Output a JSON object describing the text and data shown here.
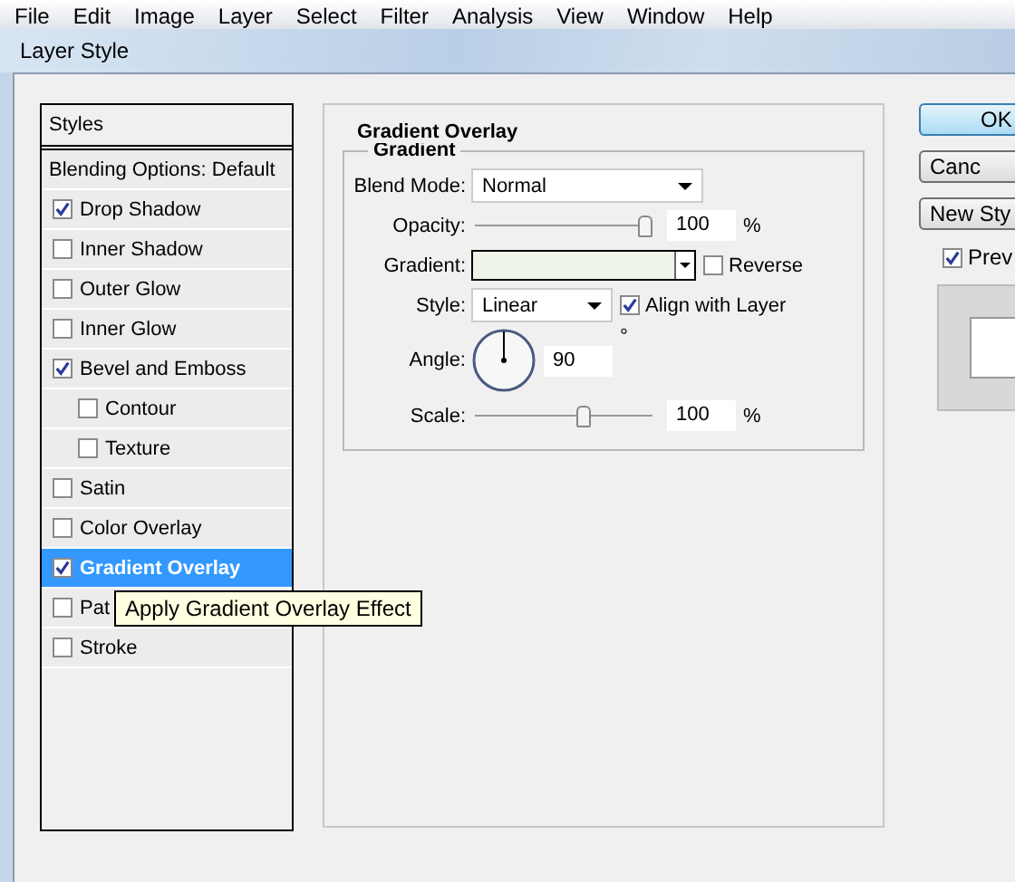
{
  "menu_bar": [
    "File",
    "Edit",
    "Image",
    "Layer",
    "Select",
    "Filter",
    "Analysis",
    "View",
    "Window",
    "Help"
  ],
  "window": {
    "title": "Layer Style"
  },
  "sidebar": {
    "header": "Styles",
    "blending_options": "Blending Options: Default",
    "items": [
      {
        "label": "Drop Shadow",
        "checked": true,
        "selected": false
      },
      {
        "label": "Inner Shadow",
        "checked": false,
        "selected": false
      },
      {
        "label": "Outer Glow",
        "checked": false,
        "selected": false
      },
      {
        "label": "Inner Glow",
        "checked": false,
        "selected": false
      },
      {
        "label": "Bevel and Emboss",
        "checked": true,
        "selected": false,
        "children": [
          {
            "label": "Contour",
            "checked": false,
            "selected": false
          },
          {
            "label": "Texture",
            "checked": false,
            "selected": false
          }
        ]
      },
      {
        "label": "Satin",
        "checked": false,
        "selected": false
      },
      {
        "label": "Color Overlay",
        "checked": false,
        "selected": false
      },
      {
        "label": "Gradient Overlay",
        "checked": true,
        "selected": true
      },
      {
        "label": "Pat",
        "checked": false,
        "selected": false
      },
      {
        "label": "Stroke",
        "checked": false,
        "selected": false
      }
    ]
  },
  "tooltip": "Apply Gradient Overlay Effect",
  "panel": {
    "title": "Gradient Overlay",
    "group": "Gradient",
    "blend_mode": {
      "label": "Blend Mode:",
      "value": "Normal"
    },
    "opacity": {
      "label": "Opacity:",
      "level": 1.0,
      "value": "100",
      "unit": "%"
    },
    "gradient": {
      "label": "Gradient:"
    },
    "reverse": {
      "label": "Reverse",
      "checked": false
    },
    "style": {
      "label": "Style:",
      "value": "Linear"
    },
    "align_with_layer": {
      "label": "Align with Layer",
      "checked": true
    },
    "angle": {
      "label": "Angle:",
      "value": "90",
      "unit": "°"
    },
    "scale": {
      "label": "Scale:",
      "level": 0.62,
      "value": "100",
      "unit": "%"
    }
  },
  "buttons": [
    {
      "label": "OK",
      "selected": true
    },
    {
      "label": "Canc",
      "selected": false
    },
    {
      "label": "New Sty",
      "selected": false
    }
  ],
  "preview": {
    "label": "Prev",
    "checked": true
  }
}
